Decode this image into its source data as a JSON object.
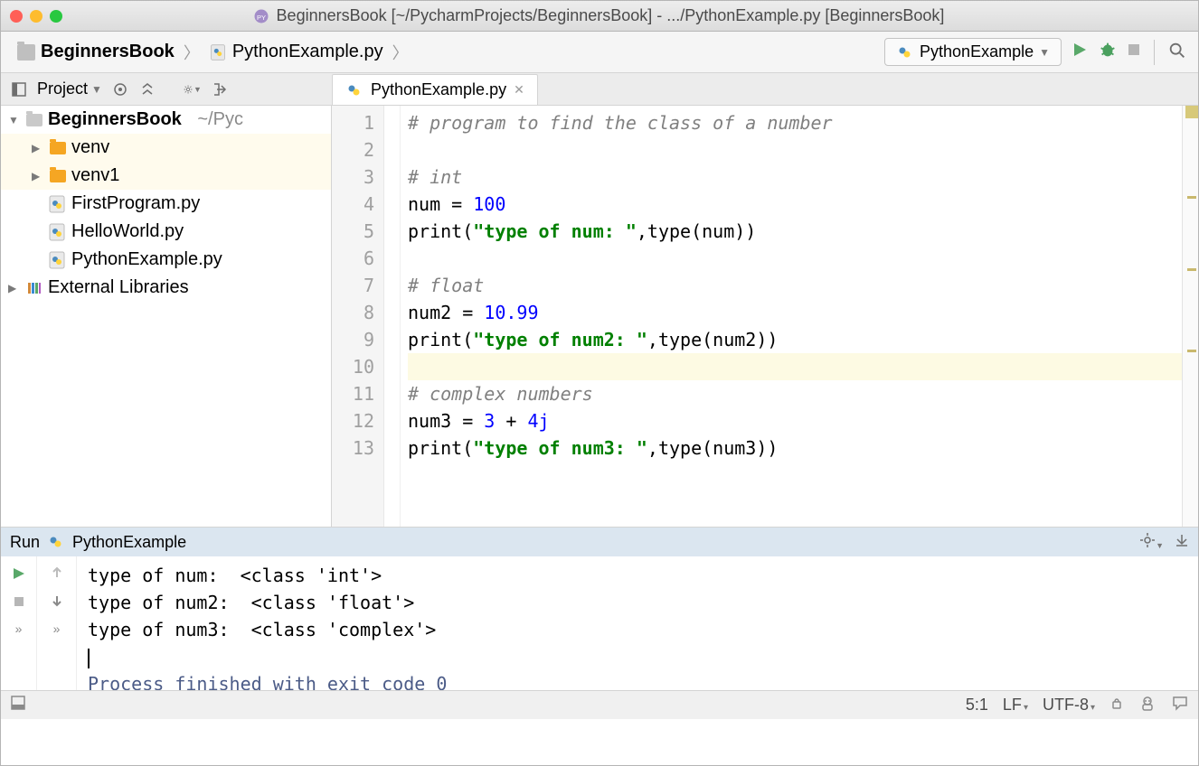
{
  "title": "BeginnersBook [~/PycharmProjects/BeginnersBook] - .../PythonExample.py [BeginnersBook]",
  "breadcrumbs": {
    "root": "BeginnersBook",
    "file": "PythonExample.py"
  },
  "run_config": "PythonExample",
  "toolpanel": {
    "project": "Project"
  },
  "tree": {
    "root": "BeginnersBook",
    "root_path": "~/Pyc",
    "venv": "venv",
    "venv1": "venv1",
    "f1": "FirstProgram.py",
    "f2": "HelloWorld.py",
    "f3": "PythonExample.py",
    "ext": "External Libraries"
  },
  "tab": {
    "name": "PythonExample.py"
  },
  "gutter_lines": [
    "1",
    "2",
    "3",
    "4",
    "5",
    "6",
    "7",
    "8",
    "9",
    "10",
    "11",
    "12",
    "13"
  ],
  "code": {
    "l1_comment": "# program to find the class of a number",
    "l3_comment": "# int",
    "l4_pre": "num = ",
    "l4_num": "100",
    "l5_pre": "print(",
    "l5_str": "\"type of num: \"",
    "l5_mid": ",type(num))",
    "l7_comment": "# float",
    "l8_pre": "num2 = ",
    "l8_num": "10.99",
    "l9_pre": "print(",
    "l9_str": "\"type of num2: \"",
    "l9_mid": ",type(num2))",
    "l11_comment": "# complex numbers",
    "l12_pre": "num3 = ",
    "l12_n1": "3",
    "l12_plus": " + ",
    "l12_n2": "4j",
    "l13_pre": "print(",
    "l13_str": "\"type of num3: \"",
    "l13_mid": ",type(num3))"
  },
  "run": {
    "label": "Run",
    "name": "PythonExample"
  },
  "console": {
    "l1": "type of num:  <class 'int'>",
    "l2": "type of num2:  <class 'float'>",
    "l3": "type of num3:  <class 'complex'>",
    "exit": "Process finished with exit code 0"
  },
  "status": {
    "pos": "5:1",
    "le": "LF",
    "enc": "UTF-8"
  }
}
